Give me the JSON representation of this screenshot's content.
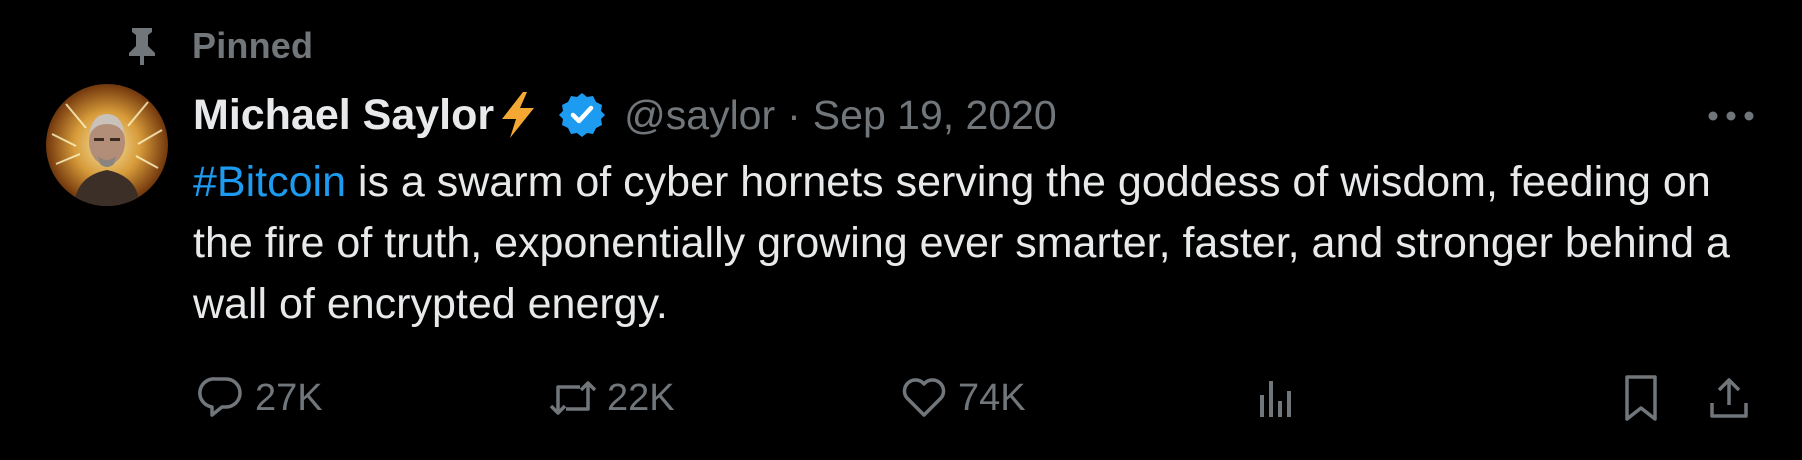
{
  "pinned": {
    "label": "Pinned"
  },
  "author": {
    "name": "Michael Saylor",
    "handle": "@saylor",
    "separator": "·",
    "timestamp": "Sep 19, 2020"
  },
  "tweet": {
    "hashtag": "#Bitcoin",
    "text": " is a swarm of cyber hornets serving the goddess of wisdom, feeding on the fire of truth, exponentially growing ever smarter, faster, and stronger behind a wall of encrypted energy."
  },
  "actions": {
    "replies": "27K",
    "reposts": "22K",
    "likes": "74K"
  },
  "icons": {
    "pinned": "pin-icon",
    "lightning": "lightning-bolt-icon",
    "verified": "verified-badge-icon",
    "more": "more-options-icon",
    "reply": "reply-icon",
    "repost": "repost-icon",
    "like": "heart-icon",
    "views": "views-chart-icon",
    "bookmark": "bookmark-icon",
    "share": "share-icon"
  },
  "colors": {
    "background": "#000000",
    "text_primary": "#e7e9ea",
    "text_secondary": "#71767b",
    "accent": "#1d9bf0",
    "lightning": "#f4a733"
  }
}
